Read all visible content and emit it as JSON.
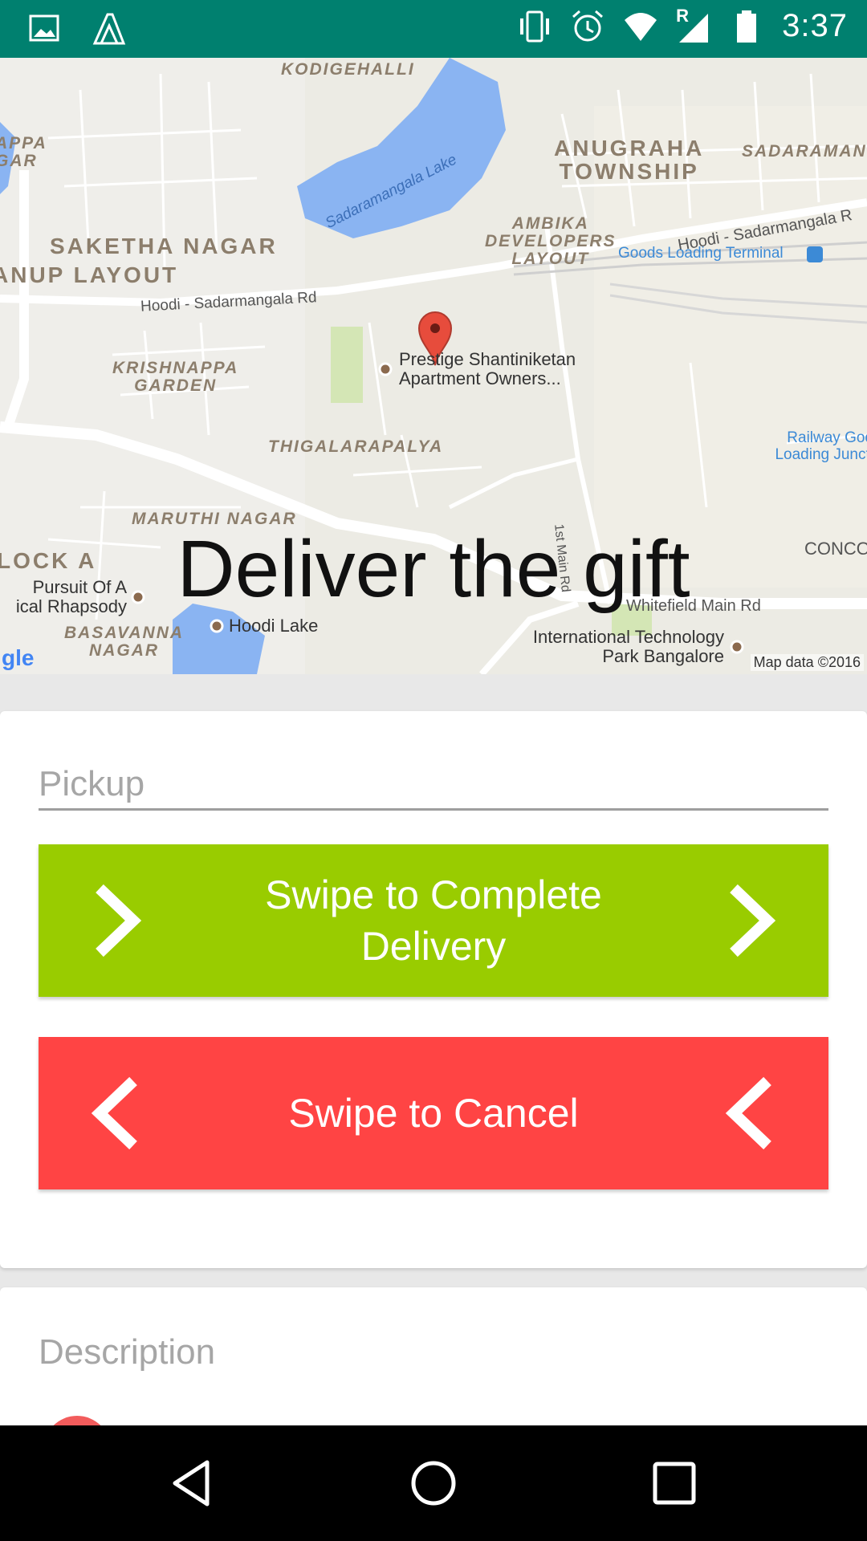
{
  "status_bar": {
    "time": "3:37",
    "left_icons": [
      "image-icon",
      "app-notification-icon"
    ],
    "right_icons": [
      "vibrate-icon",
      "alarm-icon",
      "wifi-icon",
      "cell-signal-icon",
      "battery-icon"
    ],
    "signal_roaming_letter": "R",
    "background_color": "#00806f"
  },
  "map": {
    "area_labels": [
      {
        "text": "KODIGEHALLI"
      },
      {
        "text": "ANUGRAHA\nTOWNSHIP"
      },
      {
        "text": "SADARAMAN"
      },
      {
        "text": "APPA\nGAR"
      },
      {
        "text": "SAKETHA NAGAR"
      },
      {
        "text": "ANUP LAYOUT"
      },
      {
        "text": "AMBIKA\nDEVELOPERS\nLAYOUT"
      },
      {
        "text": "KRISHNAPPA\nGARDEN"
      },
      {
        "text": "THIGALARAPALYA"
      },
      {
        "text": "MARUTHI NAGAR"
      },
      {
        "text": "LOCK A"
      },
      {
        "text": "BASAVANNA\nNAGAR"
      },
      {
        "text": "CONCO"
      }
    ],
    "roads": [
      {
        "text": "Hoodi - Sadarmangala Rd"
      },
      {
        "text": "Hoodi - Sadarmangala R"
      },
      {
        "text": "1st Main Rd"
      },
      {
        "text": "Whitefield Main Rd"
      },
      {
        "text": "Sadaramangala Lake"
      }
    ],
    "pois": [
      {
        "text": "Prestige Shantiniketan\nApartment Owners..."
      },
      {
        "text": "Pursuit Of A\nical Rhapsody"
      },
      {
        "text": "Hoodi Lake"
      },
      {
        "text": "International Technology\nPark Bangalore"
      }
    ],
    "transit_labels": [
      {
        "text": "Goods Loading Terminal"
      },
      {
        "text": "Railway Goo\nLoading Juncti"
      }
    ],
    "brand": "gle",
    "copyright": "Map data ©2016",
    "marker_icon": "map-pin-icon",
    "overlay_title": "Deliver the gift"
  },
  "form": {
    "pickup_placeholder": "Pickup",
    "swipe_complete": {
      "label": "Swipe to Complete Delivery",
      "color": "#99cc00",
      "icon": "chevron-right-icon"
    },
    "swipe_cancel": {
      "label": "Swipe to Cancel",
      "color": "#ff4444",
      "icon": "chevron-left-icon"
    }
  },
  "description": {
    "label": "Description"
  },
  "nav_bar": {
    "buttons": [
      "back-icon",
      "home-icon",
      "recents-icon"
    ]
  }
}
